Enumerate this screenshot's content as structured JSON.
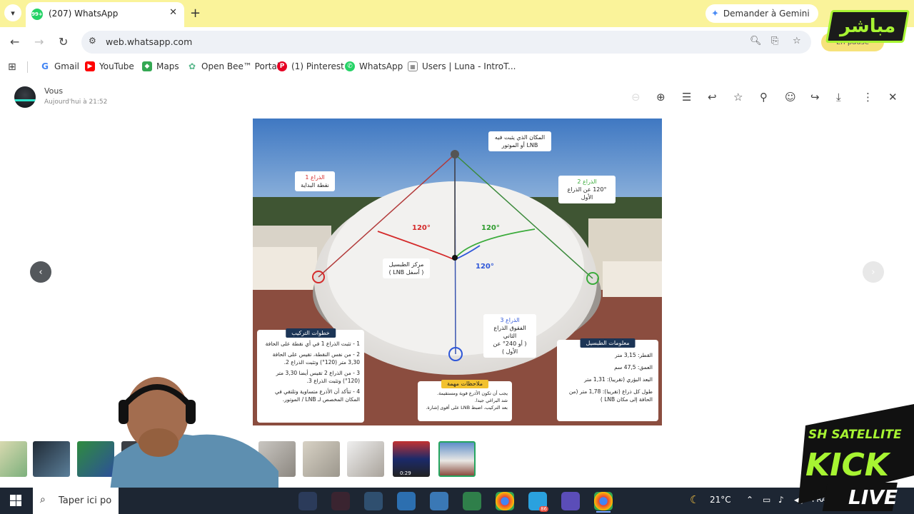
{
  "browser": {
    "tab": {
      "title": "(207) WhatsApp",
      "badge": "99+"
    },
    "gemini_button": "Demander à Gemini",
    "url": "web.whatsapp.com",
    "profile_button": "En pause",
    "bookmarks": [
      {
        "label": "Gmail",
        "icon": "gmail-icon"
      },
      {
        "label": "YouTube",
        "icon": "youtube-icon"
      },
      {
        "label": "Maps",
        "icon": "maps-icon"
      },
      {
        "label": "Open Bee™ Portal",
        "icon": "openbee-icon"
      },
      {
        "label": "(1) Pinterest",
        "icon": "pinterest-icon"
      },
      {
        "label": "WhatsApp",
        "icon": "whatsapp-icon"
      },
      {
        "label": "Users | Luna - IntroT...",
        "icon": "luna-icon"
      }
    ]
  },
  "viewer": {
    "sender": "Vous",
    "timestamp": "Aujourd'hui à 21:52",
    "image_text": {
      "label_top": "المكان الذي يثبت فيه LNB أو الموتور",
      "label_arm1_title": "الذراع 1",
      "label_arm1_sub": "نقطة البداية",
      "label_arm2_title": "الذراع 2",
      "label_arm2_sub": "120° عن الذراع الأول",
      "label_center_title": "مركز الطبسيل",
      "label_center_sub": "( أسفل LNB )",
      "label_arm3_title": "الذراع 3",
      "label_arm3_sub1": "الفقوق الذراع الثاني",
      "label_arm3_sub2": "( أو 240° عن الأول )",
      "angle_left": "120°",
      "angle_right": "120°",
      "angle_bottom": "120°",
      "steps_title": "خطوات التركيب",
      "steps": [
        "1 - تثبت الذراع 1 في أي نقطة على الحافة",
        "2 - من نفس النقطة، تقيس على الحافة 3,30 متر (120°) وتثبت الذراع 2.",
        "3 - من الذراع 2 تقيس أيضا 3,30 متر (120°) وتثبت الذراع 3.",
        "4 - تتأكد أن الأذرع متساوية وتلتقي في المكان المخصص لـ LNB / الموتور."
      ],
      "notes_title": "ملاحظات مهمة",
      "notes": [
        "يجب أن تكون الأذرع قوية ومستقيمة.",
        "شد البراغي جيدا.",
        "بعد التركيب، اضبط LNB على أقوى إشارة."
      ],
      "info_title": "معلومات الطبسيل",
      "info": [
        "القطر: 3,15 متر",
        "العمق: 47,5 سم",
        "البعد البؤري (تقريبا): 1,31 متر",
        "طول كل ذراع (تقريبا): 1,78 متر (من الحافة إلى مكان LNB )"
      ]
    },
    "thumbnail_duration": "0:29"
  },
  "taskbar": {
    "search_placeholder": "Taper ici po",
    "weather": "21°C",
    "language": "FRA",
    "chrome_badge": "86",
    "clock_partial": "0"
  },
  "overlays": {
    "watermark_text": "مباشر",
    "kick_brand": "SH SATELLITE",
    "kick_word": "KICK",
    "kick_live": "LIVE"
  },
  "colors": {
    "tabstrip": "#faf39a",
    "accent_green": "#a7f432",
    "whatsapp": "#25d366"
  }
}
